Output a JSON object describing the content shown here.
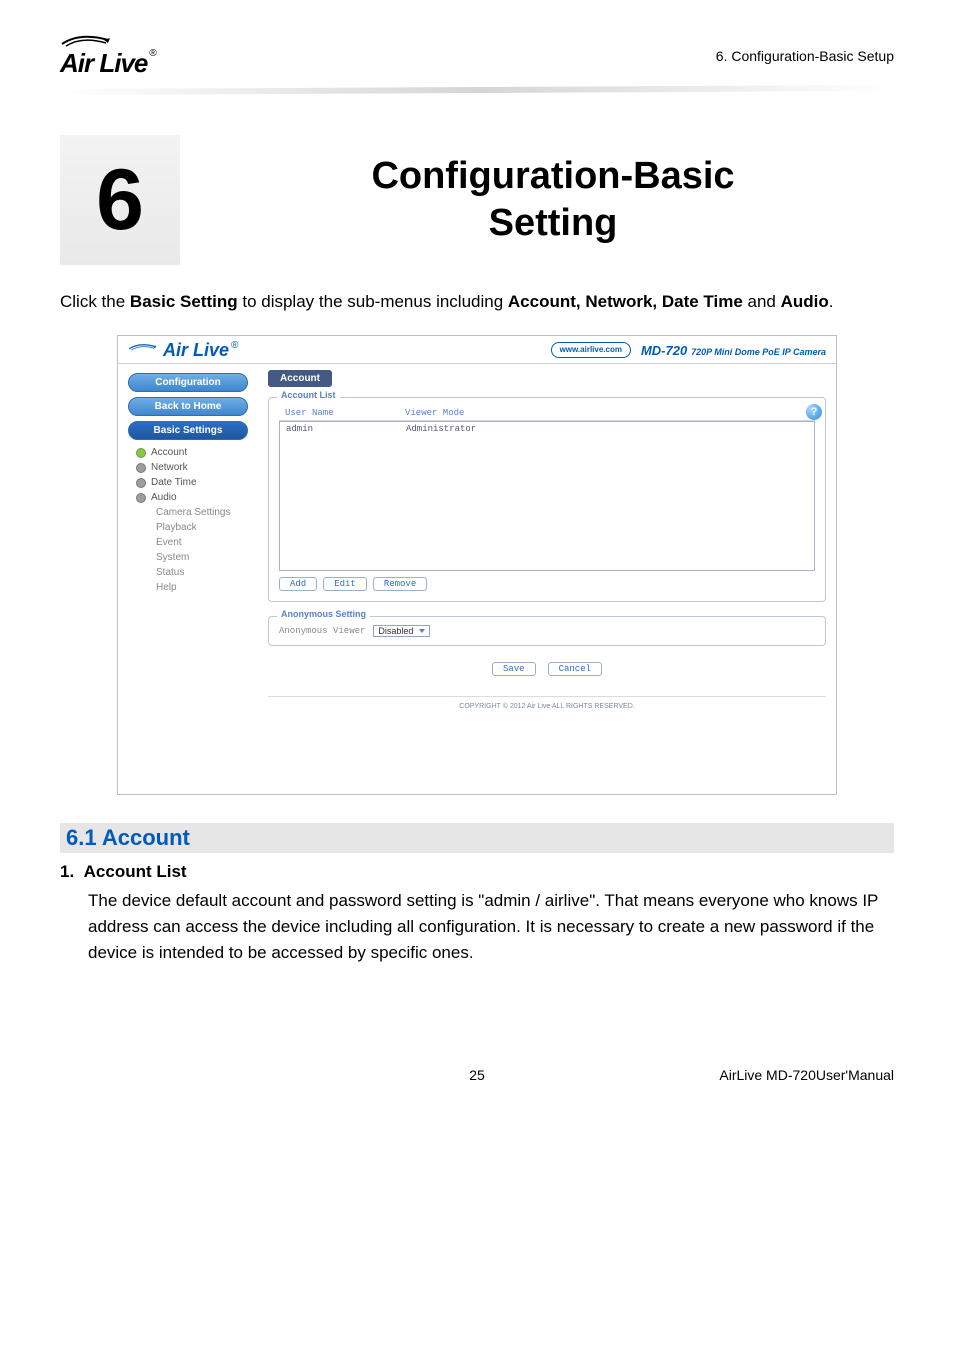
{
  "header": {
    "brand": "Air Live",
    "chapter_ref": "6. Configuration-Basic Setup"
  },
  "chapter": {
    "number": "6",
    "title_line1": "Configuration-Basic",
    "title_line2": "Setting"
  },
  "intro": {
    "prefix": "Click the ",
    "bold1": "Basic Setting",
    "mid": " to display the sub-menus including ",
    "bold2": "Account, Network, Date Time",
    "tail": " and ",
    "bold3": "Audio",
    "period": "."
  },
  "screenshot": {
    "brand": "Air Live",
    "url_pill": "www.airlive.com",
    "model": "MD-720",
    "model_sub": "720P Mini Dome PoE IP Camera",
    "sidebar": {
      "configuration": "Configuration",
      "back_to_home": "Back to Home",
      "basic_settings": "Basic Settings",
      "account": "Account",
      "network": "Network",
      "date_time": "Date Time",
      "audio": "Audio",
      "camera_settings": "Camera Settings",
      "playback": "Playback",
      "event": "Event",
      "system": "System",
      "status": "Status",
      "help": "Help"
    },
    "panel": {
      "tab": "Account",
      "fieldset_label": "Account List",
      "col_user": "User Name",
      "col_mode": "Viewer Mode",
      "row_user": "admin",
      "row_mode": "Administrator",
      "add": "Add",
      "edit": "Edit",
      "remove": "Remove",
      "anon_label": "Anonymous Setting",
      "anon_viewer": "Anonymous Viewer",
      "anon_value": "Disabled",
      "save": "Save",
      "cancel": "Cancel",
      "help_icon": "?",
      "copyright": "COPYRIGHT © 2012 Air Live ALL RIGHTS RESERVED."
    }
  },
  "section": {
    "heading": "6.1 Account",
    "item_num": "1.",
    "item_title": "Account List",
    "item_body": "The device default account and password setting is \"admin / airlive\". That means everyone who knows IP address can access the device including all configuration. It is necessary to create a new password if the device is intended to be accessed by specific ones."
  },
  "footer": {
    "page": "25",
    "manual": "AirLive MD-720User'Manual"
  }
}
